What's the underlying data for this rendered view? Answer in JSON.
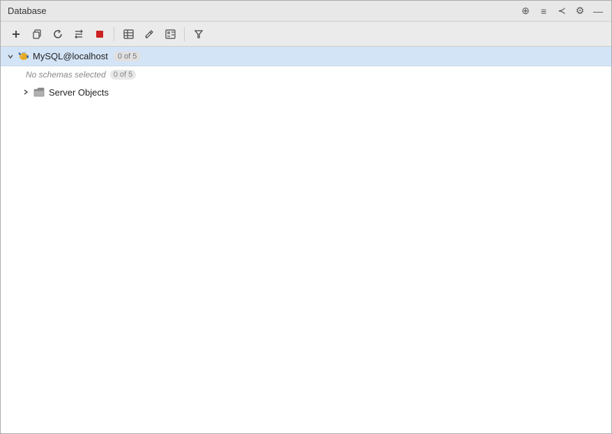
{
  "window": {
    "title": "Database"
  },
  "titlebar": {
    "title": "Database",
    "icons": {
      "globe": "⊕",
      "list": "≡",
      "filter_lines": "≺",
      "settings": "⚙",
      "minimize": "—"
    }
  },
  "toolbar": {
    "buttons": [
      {
        "name": "add-button",
        "label": "+",
        "tooltip": "Add"
      },
      {
        "name": "copy-button",
        "label": "❐",
        "tooltip": "Copy"
      },
      {
        "name": "refresh-button",
        "label": "↻",
        "tooltip": "Refresh"
      },
      {
        "name": "filter-group-button",
        "label": "⇅",
        "tooltip": "Filter Group"
      },
      {
        "name": "stop-button",
        "label": "■",
        "tooltip": "Stop",
        "red": true
      },
      {
        "name": "table-button",
        "label": "⊞",
        "tooltip": "Table"
      },
      {
        "name": "edit-button",
        "label": "✎",
        "tooltip": "Edit"
      },
      {
        "name": "view-button",
        "label": "▣",
        "tooltip": "View"
      },
      {
        "name": "filter-button",
        "label": "▼",
        "tooltip": "Filter"
      }
    ]
  },
  "tree": {
    "root": {
      "connection_label": "MySQL@localhost",
      "badge": "0 of 5",
      "expanded": true,
      "children": {
        "no_schemas_text": "No schemas selected",
        "no_schemas_badge": "0 of 5",
        "server_objects": {
          "label": "Server Objects",
          "expanded": false
        }
      }
    }
  }
}
